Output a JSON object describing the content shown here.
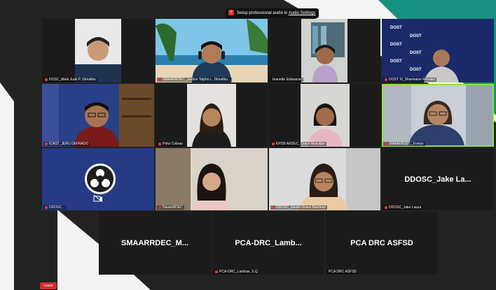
{
  "notice": {
    "text": "Setup professional audio in ",
    "link": "Audio Settings"
  },
  "tiles": [
    {
      "name": "DOSC_Mark Jude P. Dimalibo"
    },
    {
      "name": "SMAARRDEC_Justine Talpho L. Dimalibo..."
    },
    {
      "name": "Jeanette Ediaracon"
    },
    {
      "name": "DOST XI_Sharmaine Morales"
    },
    {
      "name": "ICAST_JERU DEFRADO"
    },
    {
      "name": "Pnhz Cobrao"
    },
    {
      "name": "EPDB ARDEC_Grace Maicalpe"
    },
    {
      "name": "SMAARRDEC_Evelyn"
    },
    {
      "name": "DDOSC..."
    },
    {
      "name": "DavaoRDEC"
    },
    {
      "name": "DDOSC_Geolie Grace Martinez"
    },
    {
      "name": "DDOSC_Jake Lauza",
      "big": "DDOSC_Jake La..."
    },
    {
      "big": "SMAARRDEC_M..."
    },
    {
      "name": "PCA-DRC_Lambas, S.Q.",
      "big": "PCA-DRC_Lamb..."
    },
    {
      "name": "PCA DRC ASFSD",
      "big": "PCA DRC ASFSD"
    }
  ],
  "dost_logo": "DOST",
  "leave_label": "Leave",
  "colors": {
    "accent_teal": "#17917f",
    "active_border": "#8fe33b",
    "leave_red": "#d42b2b"
  }
}
